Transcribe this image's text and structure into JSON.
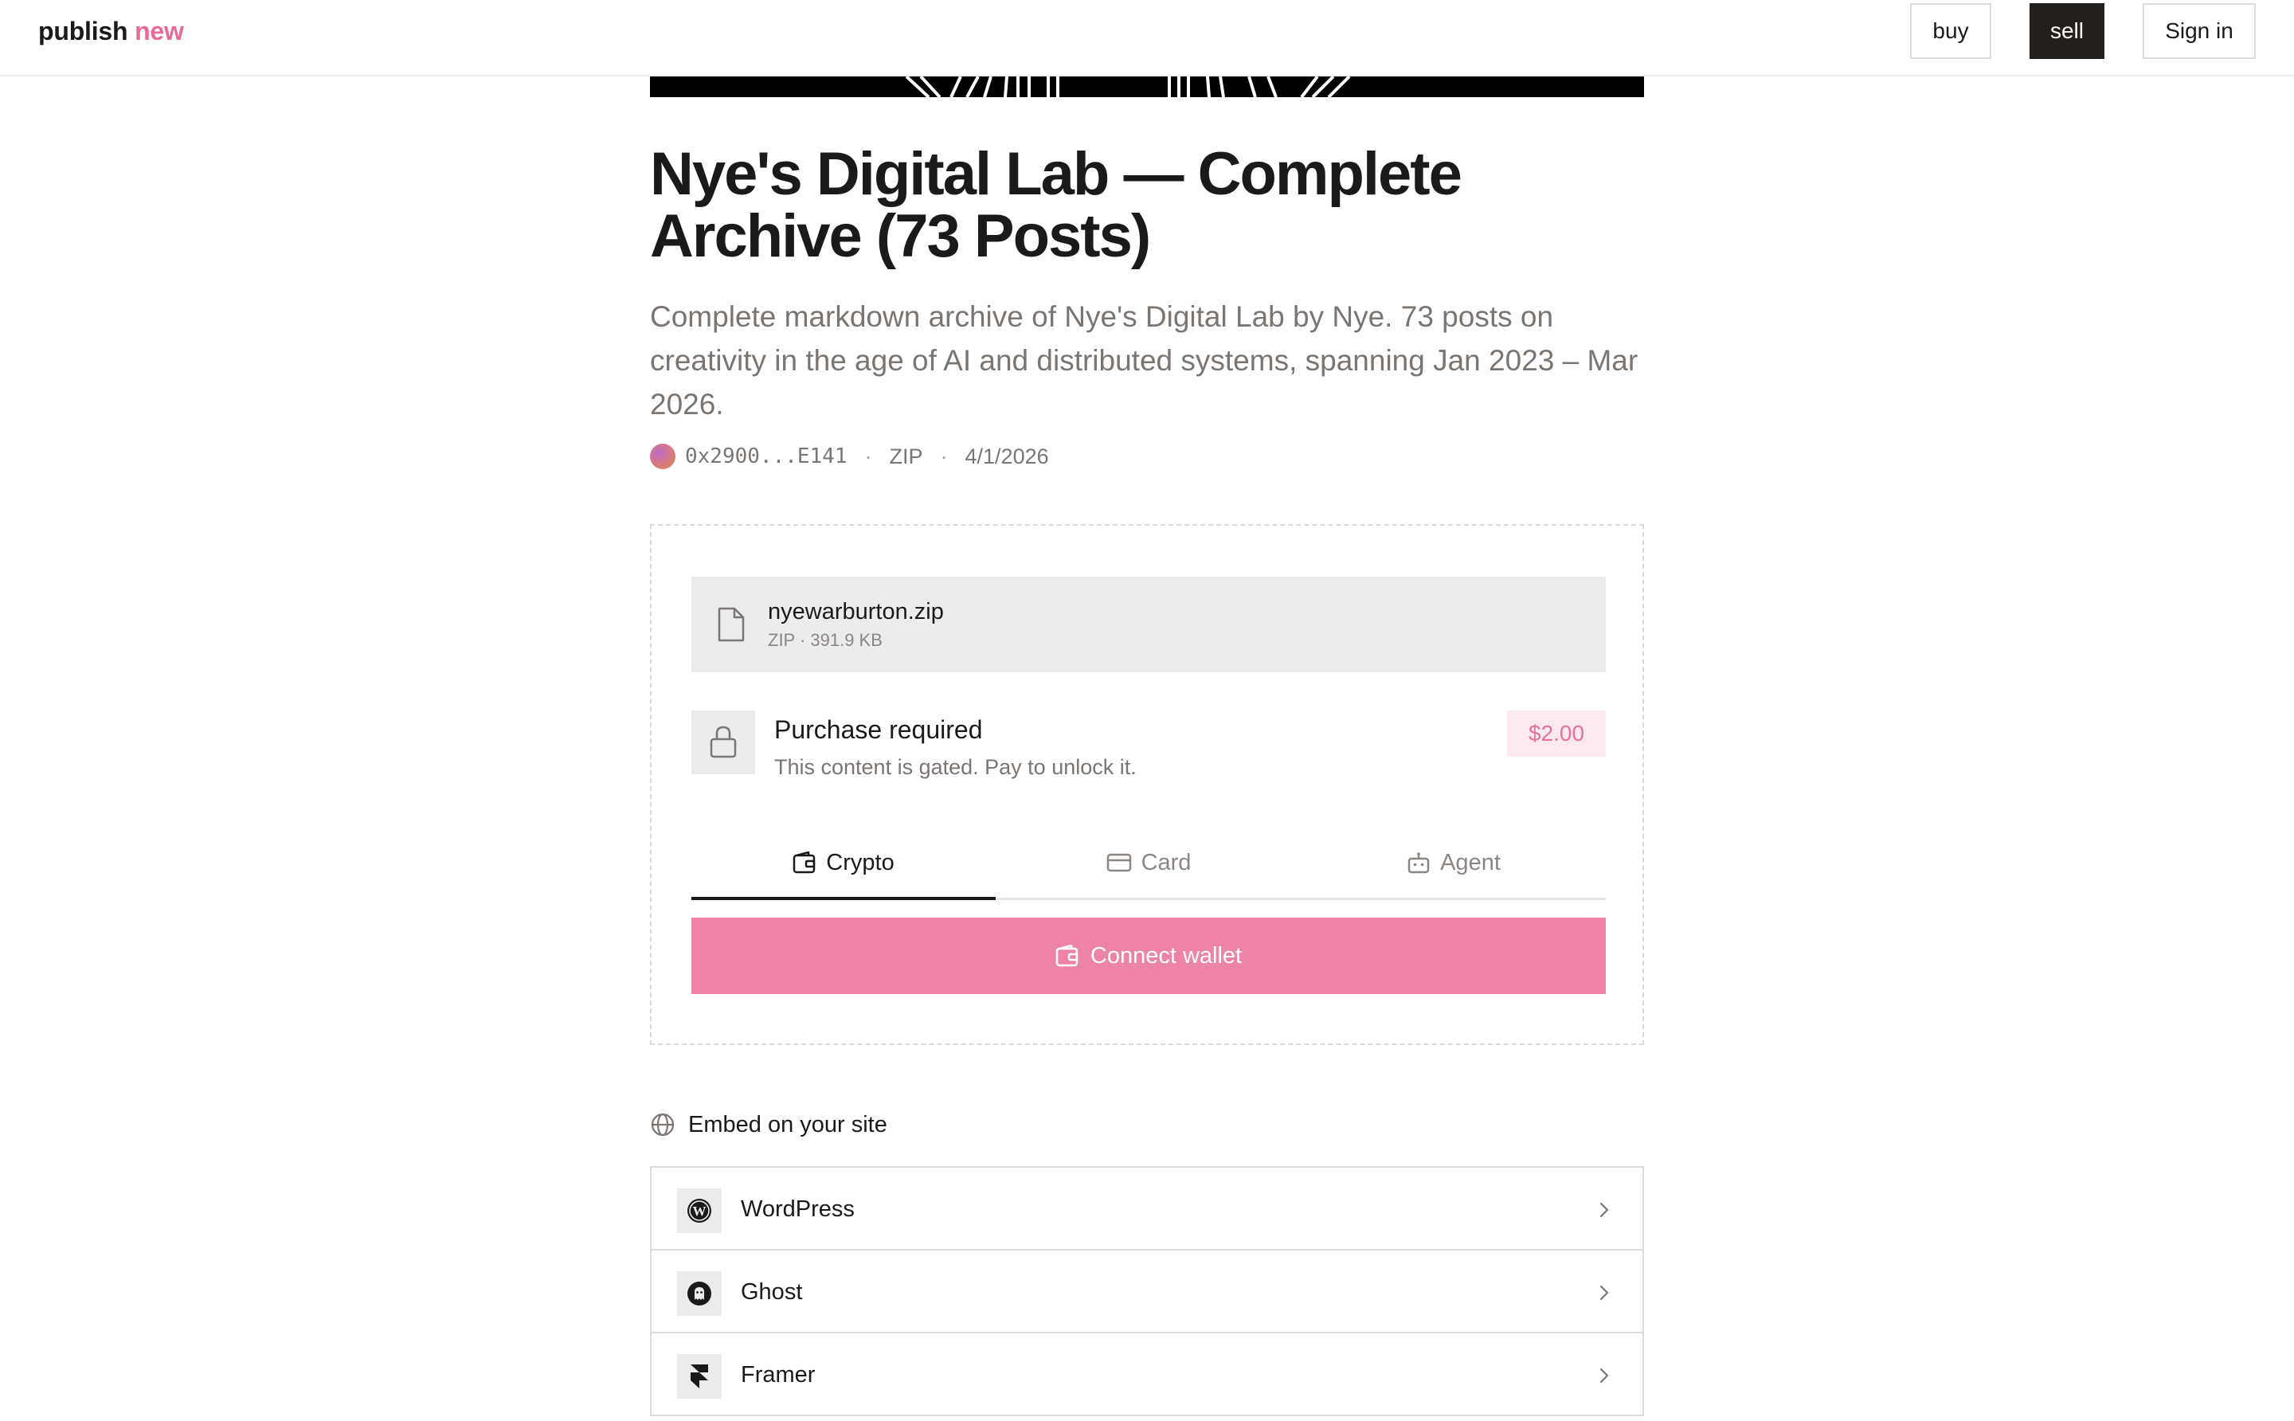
{
  "header": {
    "brand_main": "publish",
    "brand_accent": "new",
    "buy_label": "buy",
    "sell_label": "sell",
    "signin_label": "Sign in"
  },
  "product": {
    "title": "Nye's Digital Lab — Complete Archive (73 Posts)",
    "description": "Complete markdown archive of Nye's Digital Lab by Nye. 73 posts on creativity in the age of AI and distributed systems, spanning Jan 2023 – Mar 2026.",
    "author_address": "0x2900...E141",
    "format": "ZIP",
    "date": "4/1/2026"
  },
  "file": {
    "name": "nyewarburton.zip",
    "meta": "ZIP · 391.9 KB"
  },
  "purchase": {
    "heading": "Purchase required",
    "note": "This content is gated. Pay to unlock it.",
    "price": "$2.00"
  },
  "tabs": [
    {
      "label": "Crypto",
      "icon": "wallet-icon",
      "active": true
    },
    {
      "label": "Card",
      "icon": "credit-card-icon",
      "active": false
    },
    {
      "label": "Agent",
      "icon": "robot-icon",
      "active": false
    }
  ],
  "connect_label": "Connect wallet",
  "embed": {
    "heading": "Embed on your site",
    "items": [
      {
        "label": "WordPress",
        "icon": "wordpress-logo-icon"
      },
      {
        "label": "Ghost",
        "icon": "ghost-logo-icon"
      },
      {
        "label": "Framer",
        "icon": "framer-logo-icon"
      }
    ]
  },
  "colors": {
    "accent": "#e86a9a",
    "connect_button": "#ee83a8",
    "price_bg": "#fbe9ef",
    "dark": "#231f1d"
  }
}
